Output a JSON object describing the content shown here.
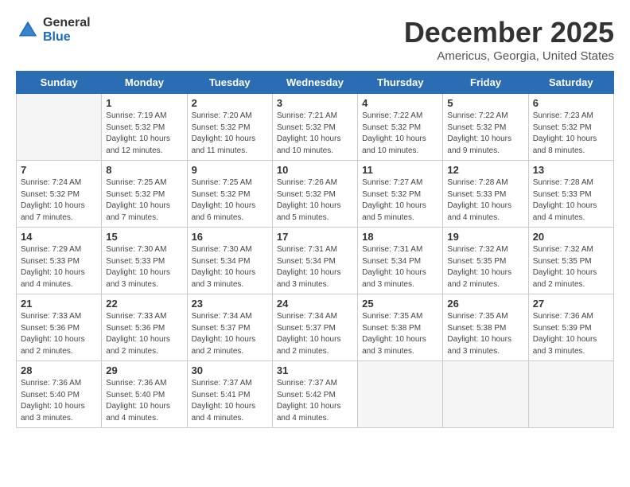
{
  "logo": {
    "general": "General",
    "blue": "Blue"
  },
  "title": "December 2025",
  "location": "Americus, Georgia, United States",
  "days_of_week": [
    "Sunday",
    "Monday",
    "Tuesday",
    "Wednesday",
    "Thursday",
    "Friday",
    "Saturday"
  ],
  "weeks": [
    [
      {
        "day": "",
        "info": ""
      },
      {
        "day": "1",
        "info": "Sunrise: 7:19 AM\nSunset: 5:32 PM\nDaylight: 10 hours\nand 12 minutes."
      },
      {
        "day": "2",
        "info": "Sunrise: 7:20 AM\nSunset: 5:32 PM\nDaylight: 10 hours\nand 11 minutes."
      },
      {
        "day": "3",
        "info": "Sunrise: 7:21 AM\nSunset: 5:32 PM\nDaylight: 10 hours\nand 10 minutes."
      },
      {
        "day": "4",
        "info": "Sunrise: 7:22 AM\nSunset: 5:32 PM\nDaylight: 10 hours\nand 10 minutes."
      },
      {
        "day": "5",
        "info": "Sunrise: 7:22 AM\nSunset: 5:32 PM\nDaylight: 10 hours\nand 9 minutes."
      },
      {
        "day": "6",
        "info": "Sunrise: 7:23 AM\nSunset: 5:32 PM\nDaylight: 10 hours\nand 8 minutes."
      }
    ],
    [
      {
        "day": "7",
        "info": "Sunrise: 7:24 AM\nSunset: 5:32 PM\nDaylight: 10 hours\nand 7 minutes."
      },
      {
        "day": "8",
        "info": "Sunrise: 7:25 AM\nSunset: 5:32 PM\nDaylight: 10 hours\nand 7 minutes."
      },
      {
        "day": "9",
        "info": "Sunrise: 7:25 AM\nSunset: 5:32 PM\nDaylight: 10 hours\nand 6 minutes."
      },
      {
        "day": "10",
        "info": "Sunrise: 7:26 AM\nSunset: 5:32 PM\nDaylight: 10 hours\nand 5 minutes."
      },
      {
        "day": "11",
        "info": "Sunrise: 7:27 AM\nSunset: 5:32 PM\nDaylight: 10 hours\nand 5 minutes."
      },
      {
        "day": "12",
        "info": "Sunrise: 7:28 AM\nSunset: 5:33 PM\nDaylight: 10 hours\nand 4 minutes."
      },
      {
        "day": "13",
        "info": "Sunrise: 7:28 AM\nSunset: 5:33 PM\nDaylight: 10 hours\nand 4 minutes."
      }
    ],
    [
      {
        "day": "14",
        "info": "Sunrise: 7:29 AM\nSunset: 5:33 PM\nDaylight: 10 hours\nand 4 minutes."
      },
      {
        "day": "15",
        "info": "Sunrise: 7:30 AM\nSunset: 5:33 PM\nDaylight: 10 hours\nand 3 minutes."
      },
      {
        "day": "16",
        "info": "Sunrise: 7:30 AM\nSunset: 5:34 PM\nDaylight: 10 hours\nand 3 minutes."
      },
      {
        "day": "17",
        "info": "Sunrise: 7:31 AM\nSunset: 5:34 PM\nDaylight: 10 hours\nand 3 minutes."
      },
      {
        "day": "18",
        "info": "Sunrise: 7:31 AM\nSunset: 5:34 PM\nDaylight: 10 hours\nand 3 minutes."
      },
      {
        "day": "19",
        "info": "Sunrise: 7:32 AM\nSunset: 5:35 PM\nDaylight: 10 hours\nand 2 minutes."
      },
      {
        "day": "20",
        "info": "Sunrise: 7:32 AM\nSunset: 5:35 PM\nDaylight: 10 hours\nand 2 minutes."
      }
    ],
    [
      {
        "day": "21",
        "info": "Sunrise: 7:33 AM\nSunset: 5:36 PM\nDaylight: 10 hours\nand 2 minutes."
      },
      {
        "day": "22",
        "info": "Sunrise: 7:33 AM\nSunset: 5:36 PM\nDaylight: 10 hours\nand 2 minutes."
      },
      {
        "day": "23",
        "info": "Sunrise: 7:34 AM\nSunset: 5:37 PM\nDaylight: 10 hours\nand 2 minutes."
      },
      {
        "day": "24",
        "info": "Sunrise: 7:34 AM\nSunset: 5:37 PM\nDaylight: 10 hours\nand 2 minutes."
      },
      {
        "day": "25",
        "info": "Sunrise: 7:35 AM\nSunset: 5:38 PM\nDaylight: 10 hours\nand 3 minutes."
      },
      {
        "day": "26",
        "info": "Sunrise: 7:35 AM\nSunset: 5:38 PM\nDaylight: 10 hours\nand 3 minutes."
      },
      {
        "day": "27",
        "info": "Sunrise: 7:36 AM\nSunset: 5:39 PM\nDaylight: 10 hours\nand 3 minutes."
      }
    ],
    [
      {
        "day": "28",
        "info": "Sunrise: 7:36 AM\nSunset: 5:40 PM\nDaylight: 10 hours\nand 3 minutes."
      },
      {
        "day": "29",
        "info": "Sunrise: 7:36 AM\nSunset: 5:40 PM\nDaylight: 10 hours\nand 4 minutes."
      },
      {
        "day": "30",
        "info": "Sunrise: 7:37 AM\nSunset: 5:41 PM\nDaylight: 10 hours\nand 4 minutes."
      },
      {
        "day": "31",
        "info": "Sunrise: 7:37 AM\nSunset: 5:42 PM\nDaylight: 10 hours\nand 4 minutes."
      },
      {
        "day": "",
        "info": ""
      },
      {
        "day": "",
        "info": ""
      },
      {
        "day": "",
        "info": ""
      }
    ]
  ]
}
